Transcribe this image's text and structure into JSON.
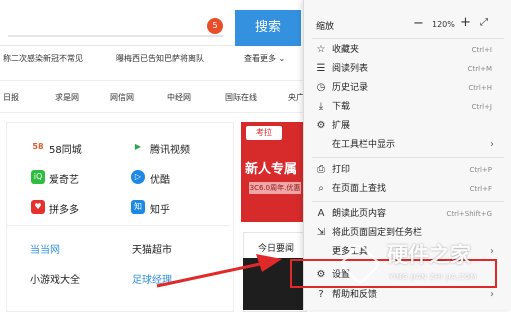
{
  "search": {
    "badge": "5",
    "button": "搜索"
  },
  "hot": {
    "items": [
      "称二次感染新冠不常见",
      "曝梅西已告知巴萨将离队"
    ],
    "more": "查看更多"
  },
  "sites": {
    "items": [
      "日报",
      "求是网",
      "网信网",
      "中经网",
      "国际在线",
      "央广"
    ]
  },
  "apps": [
    {
      "label": "58同城",
      "icon": "58"
    },
    {
      "label": "腾讯视频",
      "icon": "▶"
    },
    {
      "label": "爱奇艺",
      "icon": "iQ"
    },
    {
      "label": "优酷",
      "icon": "▷"
    },
    {
      "label": "拼多多",
      "icon": "♥"
    },
    {
      "label": "知乎",
      "icon": "知"
    }
  ],
  "links": {
    "dangdang": "当当网",
    "tmall": "天猫超市",
    "games": "小游戏大全",
    "football": "足球经理"
  },
  "ad": {
    "logo": "考拉",
    "headline": "新人专属",
    "sub": "3C6.0周年.优惠"
  },
  "news": {
    "title": "今日要闻"
  },
  "menu": {
    "zoom": {
      "label": "缩放",
      "minus": "−",
      "value": "120%",
      "plus": "+",
      "fullscreen": "⤢"
    },
    "items": [
      {
        "icon": "☆",
        "label": "收藏夹",
        "shortcut": "Ctrl+I"
      },
      {
        "icon": "☰",
        "label": "阅读列表",
        "shortcut": "Ctrl+M"
      },
      {
        "icon": "◷",
        "label": "历史记录",
        "shortcut": "Ctrl+H"
      },
      {
        "icon": "⤓",
        "label": "下载",
        "shortcut": "Ctrl+J"
      },
      {
        "icon": "⚙",
        "label": "扩展",
        "shortcut": ""
      },
      {
        "icon": "",
        "label": "在工具栏中显示",
        "shortcut": ""
      },
      {
        "icon": "⎙",
        "label": "打印",
        "shortcut": "Ctrl+P"
      },
      {
        "icon": "⌕",
        "label": "在页面上查找",
        "shortcut": "Ctrl+F"
      },
      {
        "icon": "A",
        "label": "朗读此页内容",
        "shortcut": "Ctrl+Shift+G"
      },
      {
        "icon": "⇲",
        "label": "将此页面固定到任务栏",
        "shortcut": ""
      },
      {
        "icon": "",
        "label": "更多工具",
        "shortcut": ""
      },
      {
        "icon": "⚙",
        "label": "设置",
        "shortcut": ""
      },
      {
        "icon": "?",
        "label": "帮助和反馈",
        "shortcut": ""
      }
    ]
  },
  "watermark": {
    "title": "硬件之家",
    "subtitle": "YING JIAN ZHI JIA.COM"
  },
  "colors": {
    "accent": "#3391e0",
    "highlight": "#e02a2a",
    "ad": "#d72a2a"
  }
}
